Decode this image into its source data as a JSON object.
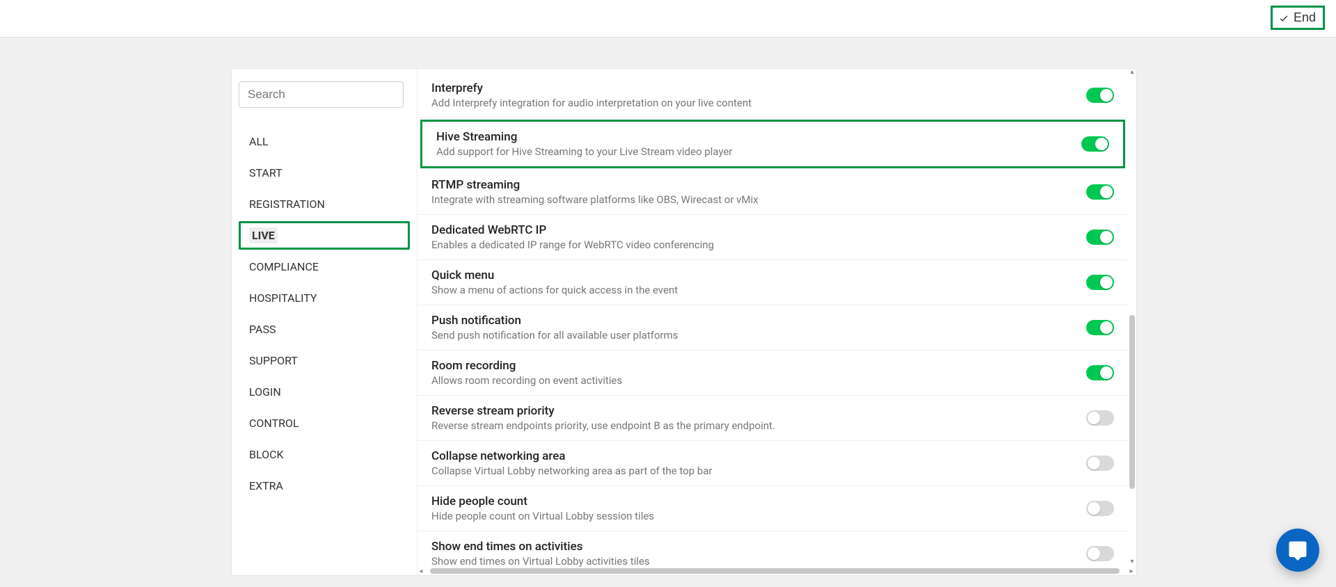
{
  "topbar": {
    "end_label": "End"
  },
  "sidebar": {
    "search_placeholder": "Search",
    "items": [
      {
        "label": "ALL"
      },
      {
        "label": "START"
      },
      {
        "label": "REGISTRATION"
      },
      {
        "label": "LIVE"
      },
      {
        "label": "COMPLIANCE"
      },
      {
        "label": "HOSPITALITY"
      },
      {
        "label": "PASS"
      },
      {
        "label": "SUPPORT"
      },
      {
        "label": "LOGIN"
      },
      {
        "label": "CONTROL"
      },
      {
        "label": "BLOCK"
      },
      {
        "label": "EXTRA"
      }
    ],
    "active_index": 3
  },
  "settings": [
    {
      "title": "Interprefy",
      "desc": "Add Interprefy integration for audio interpretation on your live content",
      "on": true,
      "highlight": false
    },
    {
      "title": "Hive Streaming",
      "desc": "Add support for Hive Streaming to your Live Stream video player",
      "on": true,
      "highlight": true
    },
    {
      "title": "RTMP streaming",
      "desc": "Integrate with streaming software platforms like OBS, Wirecast or vMix",
      "on": true,
      "highlight": false
    },
    {
      "title": "Dedicated WebRTC IP",
      "desc": "Enables a dedicated IP range for WebRTC video conferencing",
      "on": true,
      "highlight": false
    },
    {
      "title": "Quick menu",
      "desc": "Show a menu of actions for quick access in the event",
      "on": true,
      "highlight": false
    },
    {
      "title": "Push notification",
      "desc": "Send push notification for all available user platforms",
      "on": true,
      "highlight": false
    },
    {
      "title": "Room recording",
      "desc": "Allows room recording on event activities",
      "on": true,
      "highlight": false
    },
    {
      "title": "Reverse stream priority",
      "desc": "Reverse stream endpoints priority, use endpoint B as the primary endpoint.",
      "on": false,
      "highlight": false
    },
    {
      "title": "Collapse networking area",
      "desc": "Collapse Virtual Lobby networking area as part of the top bar",
      "on": false,
      "highlight": false
    },
    {
      "title": "Hide people count",
      "desc": "Hide people count on Virtual Lobby session tiles",
      "on": false,
      "highlight": false
    },
    {
      "title": "Show end times on activities",
      "desc": "Show end times on Virtual Lobby activities tiles",
      "on": false,
      "highlight": false
    }
  ]
}
